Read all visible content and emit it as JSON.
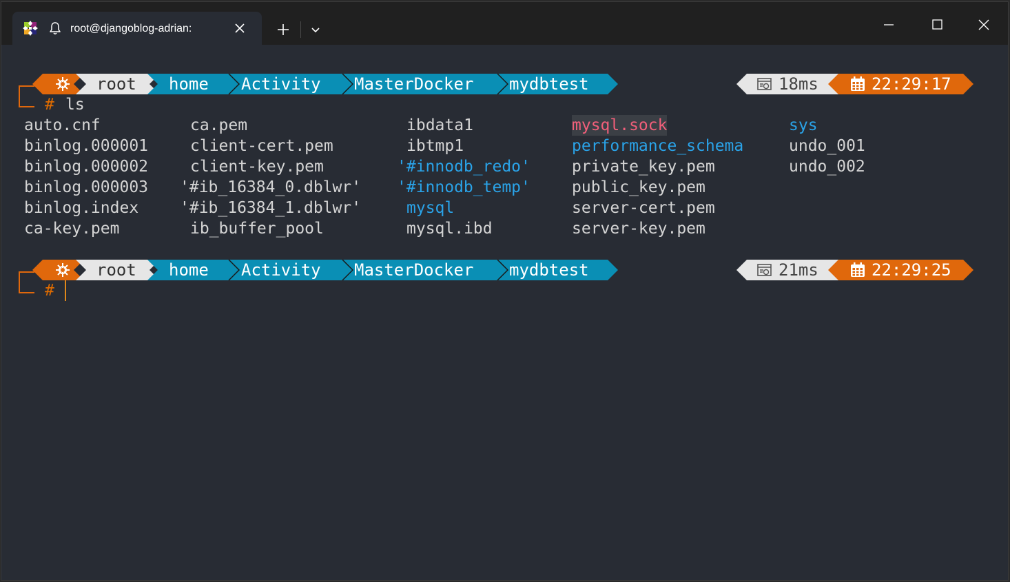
{
  "titlebar": {
    "tab_title": "root@djangoblog-adrian:",
    "icons": {
      "logo": "centos-logo-icon",
      "bell": "bell-icon",
      "close": "close-icon",
      "new_tab": "plus-icon",
      "dropdown": "chevron-down-icon",
      "minimize": "minimize-icon",
      "maximize": "maximize-icon",
      "window_close": "close-icon"
    }
  },
  "colors": {
    "terminal_bg": "#282c34",
    "segment_orange": "#e0680c",
    "segment_gray": "#e6e6e6",
    "segment_blue": "#0a8fb5",
    "directory": "#2aa3e8",
    "socket": "#f25f7a",
    "text": "#d4d4d4"
  },
  "prompts": [
    {
      "user": "root",
      "path": [
        "home",
        "Activity",
        "MasterDocker",
        "mydbtest"
      ],
      "exec_time": "18ms",
      "clock": "22:29:17",
      "symbol": "#",
      "command": "ls"
    },
    {
      "user": "root",
      "path": [
        "home",
        "Activity",
        "MasterDocker",
        "mydbtest"
      ],
      "exec_time": "21ms",
      "clock": "22:29:25",
      "symbol": "#",
      "command": ""
    }
  ],
  "ls_output": [
    [
      "auto.cnf",
      "binlog.000001",
      "binlog.000002",
      "binlog.000003",
      "binlog.index",
      "ca-key.pem"
    ],
    [
      "ca.pem",
      "client-cert.pem",
      "client-key.pem",
      "'#ib_16384_0.dblwr'",
      "'#ib_16384_1.dblwr'",
      "ib_buffer_pool"
    ],
    [
      "ibdata1",
      "ibtmp1",
      "'#innodb_redo'",
      "'#innodb_temp'",
      "mysql",
      "mysql.ibd"
    ],
    [
      "mysql.sock",
      "performance_schema",
      "private_key.pem",
      "public_key.pem",
      "server-cert.pem",
      "server-key.pem"
    ],
    [
      "sys",
      "undo_001",
      "undo_002"
    ]
  ]
}
